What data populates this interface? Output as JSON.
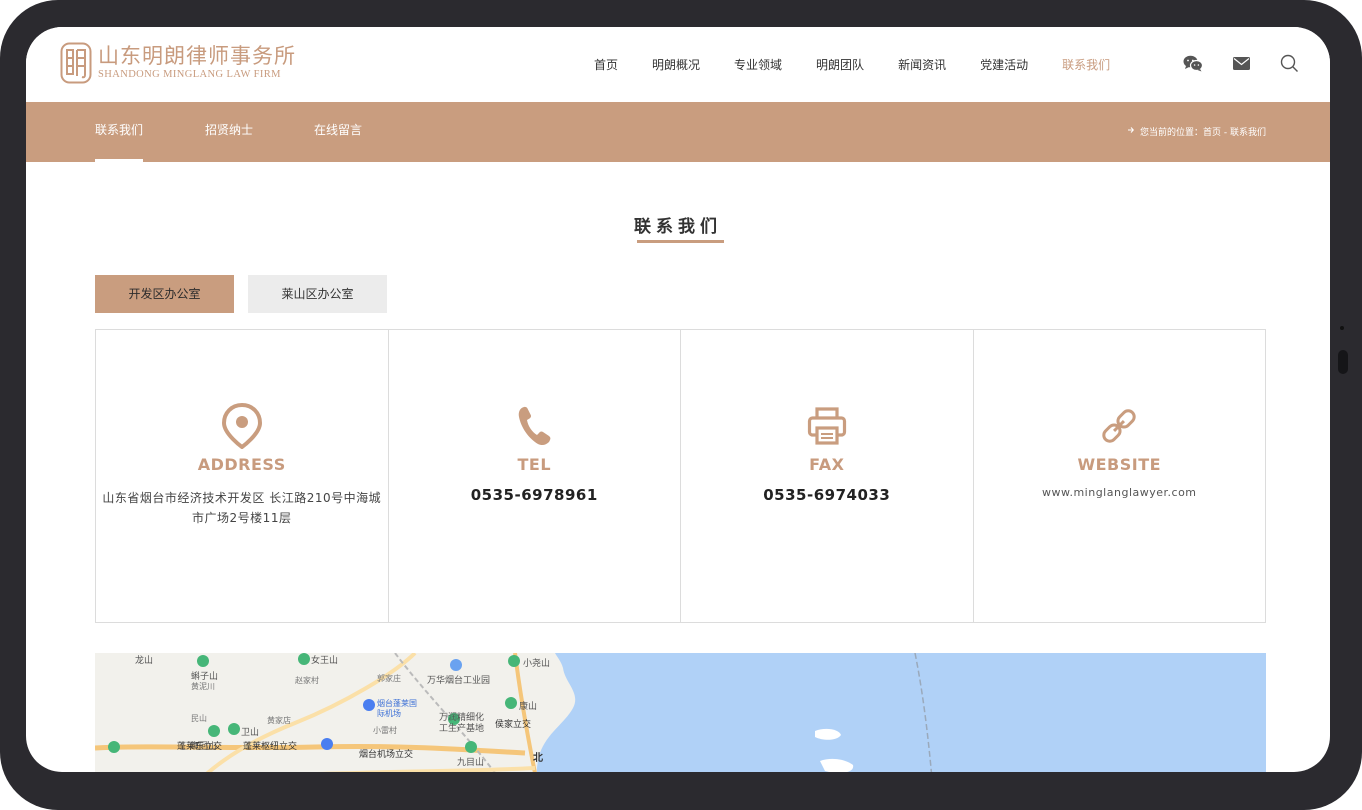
{
  "header": {
    "logo_cn": "山东明朗律师事务所",
    "logo_en": "SHANDONG MINGLANG LAW FIRM",
    "nav": [
      "首页",
      "明朗概况",
      "专业领域",
      "明朗团队",
      "新闻资讯",
      "党建活动",
      "联系我们"
    ],
    "active_nav": "联系我们",
    "tools": [
      "wechat-icon",
      "mail-icon",
      "search-icon"
    ]
  },
  "subnav": {
    "items": [
      "联系我们",
      "招贤纳士",
      "在线留言"
    ],
    "breadcrumb": "您当前的位置：首页 - 联系我们"
  },
  "section": {
    "title": "联系我们",
    "tabs": [
      "开发区办公室",
      "莱山区办公室"
    ]
  },
  "cards": {
    "address": {
      "label": "ADDRESS",
      "value": "山东省烟台市经济技术开发区 长江路210号中海城市广场2号楼11层",
      "icon": "location-pin-icon"
    },
    "tel": {
      "label": "TEL",
      "value": "0535-6978961",
      "icon": "phone-icon"
    },
    "fax": {
      "label": "FAX",
      "value": "0535-6974033",
      "icon": "printer-icon"
    },
    "website": {
      "label": "WEBSITE",
      "value": "www.minglanglawyer.com",
      "icon": "link-icon"
    }
  },
  "map": {
    "labels": [
      "龙山",
      "女王山",
      "小尧山",
      "万华烟台工业园",
      "蝌子山",
      "黄泥川",
      "赵家村",
      "郭家庄",
      "烟台蓬莱国际机场",
      "康山",
      "民山",
      "鹰回山",
      "卫山",
      "黄家店",
      "万润精细化工生产基地",
      "侯家立交",
      "蓬莱东立交",
      "蓬莱枢纽立交",
      "烟台机场立交",
      "九目山",
      "小雷村",
      "北"
    ]
  },
  "colors": {
    "accent": "#c99d7f",
    "accent_text": "#c89b7e",
    "water": "#b0d1f7",
    "land": "#f2f1ec"
  }
}
